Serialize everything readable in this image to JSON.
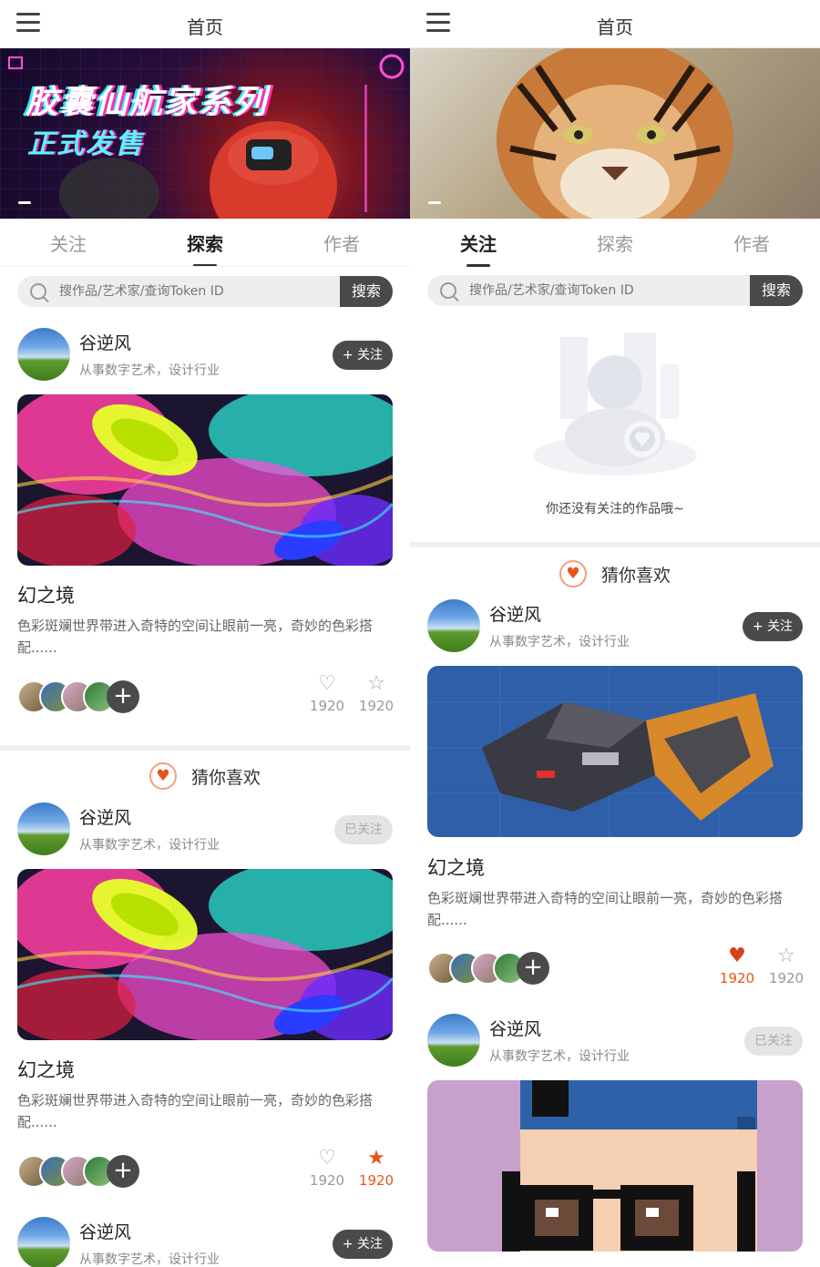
{
  "nav": {
    "title": "首页"
  },
  "tabs": {
    "follow": "关注",
    "explore": "探索",
    "authors": "作者"
  },
  "search": {
    "placeholder": "搜作品/艺术家/查询Token ID",
    "button": "搜索"
  },
  "banner_left": {
    "line1": "胶囊仙航家系列",
    "line2": "正式发售"
  },
  "author": {
    "name": "谷逆风",
    "desc": "从事数字艺术，设计行业"
  },
  "follow_label": "+ 关注",
  "followed_label": "已关注",
  "guess_label": "猜你喜欢",
  "artwork": {
    "title": "幻之境",
    "desc": "色彩斑斓世界带进入奇特的空间让眼前一亮，奇妙的色彩搭配......"
  },
  "stats": {
    "likes": "1920",
    "favorites": "1920"
  },
  "empty_text": "你还没有关注的作品哦~",
  "colors": {
    "accent": "#e8531c",
    "dark_button": "#4a4a4a"
  }
}
